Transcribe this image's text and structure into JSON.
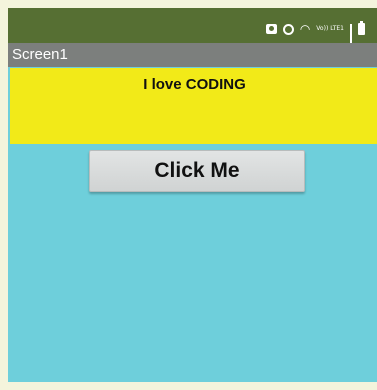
{
  "status_bar": {
    "icons": [
      "camera-icon",
      "alarm-icon",
      "wifi-icon",
      "volte-icon",
      "signal-icon",
      "battery-icon"
    ],
    "volte_text": "Vo)) LTE1",
    "background": "#566f33"
  },
  "title_bar": {
    "title": "Screen1",
    "background": "#7c7f7d"
  },
  "label": {
    "text": "I love CODING",
    "background": "#f2ea18"
  },
  "button": {
    "label": "Click Me"
  },
  "screen": {
    "background": "#6ecfdb"
  }
}
